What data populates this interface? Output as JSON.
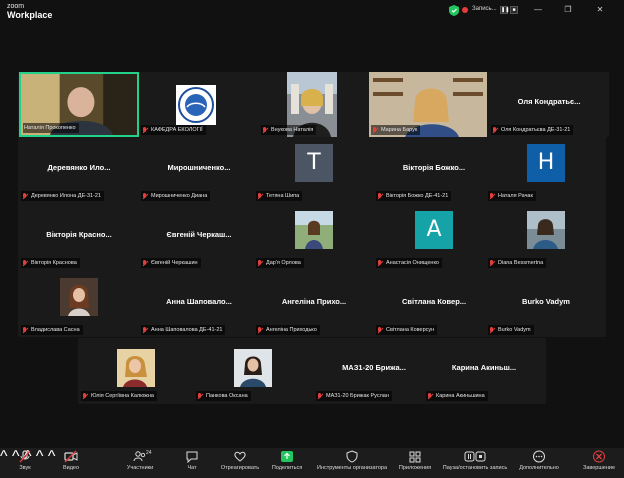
{
  "app": {
    "logo_top": "zoom",
    "logo_bottom": "Workplace"
  },
  "recording": {
    "label": "Запись..."
  },
  "colors": {
    "speaking_border": "#23d18b",
    "muted_mic": "#e0403d",
    "avatar_t": "#4b5563",
    "avatar_h": "#0e5fa8",
    "avatar_a": "#16a3a8"
  },
  "participants": [
    {
      "label": "Наталія Прокопенко"
    },
    {
      "label": "КАФЕДРА ЕКОЛОГІЇ"
    },
    {
      "label": "Внукова Наталія"
    },
    {
      "label": "Марина Барук"
    },
    {
      "big": "Оля Кондратьє...",
      "label": "Оля Кондратьєва ДЕ-31-21"
    },
    {
      "big": "Деревянко Ило...",
      "label": "Деревянко Илона ДЕ-31-21"
    },
    {
      "big": "Мирошниченко...",
      "label": "Мирошниченко Диана"
    },
    {
      "avatar": "T",
      "label": "Тетяна Шипа"
    },
    {
      "big": "Вікторія Божко...",
      "label": "Вікторія Божко ДЕ-41-21"
    },
    {
      "avatar": "H",
      "label": "Наталя Рачак"
    },
    {
      "big": "Вікторія Красно...",
      "label": "Вікторія Краснова"
    },
    {
      "big": "Євгеній Черкаш...",
      "label": "Євгеній Черкашин"
    },
    {
      "label": "Дар'я Орлова"
    },
    {
      "avatar": "A",
      "label": "Анастасія Онищенко"
    },
    {
      "label": "Diana Bessmertna"
    },
    {
      "label": "Владислава Сасна"
    },
    {
      "big": "Анна Шаповало...",
      "label": "Анна Шаповалова ДЕ-41-21"
    },
    {
      "big": "Ангеліна Прихо...",
      "label": "Ангеліна Приходько"
    },
    {
      "big": "Світлана Ковер...",
      "label": "Світлана Коверсун"
    },
    {
      "big": "Burko Vadym",
      "label": "Burko Vadym"
    },
    {
      "label": "Юлія Сергіївна Калюжна"
    },
    {
      "label": "Панкова Оксана"
    },
    {
      "big": "МАЗ1-20 Брижа...",
      "label": "МАЗ1-20 Брижак Руслан"
    },
    {
      "big": "Карина Акиньш...",
      "label": "Карина Акиньшина"
    }
  ],
  "toolbar": {
    "audio": "Звук",
    "video": "Видео",
    "participants": "Участники",
    "participants_count": "24",
    "chat": "Чат",
    "react": "Отреагировать",
    "share": "Поделиться",
    "host_tools": "Инструменты организатора",
    "apps": "Приложения",
    "pause_rec": "Пауза/остановить запись",
    "more": "Дополнительно",
    "end": "Завершение"
  }
}
